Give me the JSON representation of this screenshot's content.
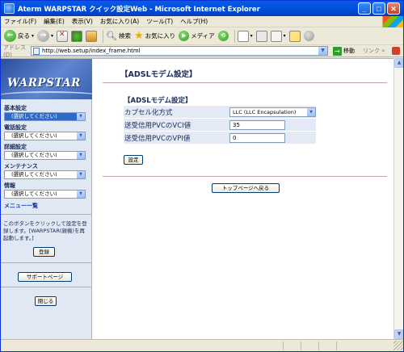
{
  "window": {
    "title": "Aterm WARPSTAR クイック設定Web - Microsoft Internet Explorer",
    "controls": {
      "minimize": "_",
      "maximize": "□",
      "close": "✕"
    }
  },
  "menu": [
    "ファイル(F)",
    "編集(E)",
    "表示(V)",
    "お気に入り(A)",
    "ツール(T)",
    "ヘルプ(H)"
  ],
  "toolbar": {
    "back": "戻る",
    "search": "検索",
    "favorites": "お気に入り",
    "media": "メディア"
  },
  "address": {
    "label": "アドレス(D)",
    "url": "http://web.setup/index_frame.html",
    "go": "移動",
    "links": "リンク »"
  },
  "sidebar": {
    "logo": "WARPSTAR",
    "groups": [
      {
        "label": "基本設定",
        "selected": "(選択してください)"
      },
      {
        "label": "電話設定",
        "selected": "(選択してください)"
      },
      {
        "label": "詳細設定",
        "selected": "(選択してください)"
      },
      {
        "label": "メンテナンス",
        "selected": "(選択してください)"
      },
      {
        "label": "情報",
        "selected": "(選択してください)"
      }
    ],
    "menu_list": "メニュー一覧",
    "help_text": "このボタンをクリックして設定を登録します。[WARPSTAR(親機)を再起動します。]",
    "register_button": "登録",
    "support_button": "サポートページ",
    "close_button": "閉じる"
  },
  "main": {
    "heading": "【ADSLモデム設定】",
    "section_title": "【ADSLモデム設定】",
    "rows": [
      {
        "label": "カプセル化方式",
        "value": "LLC (LLC Encapsulation)"
      },
      {
        "label": "送受信用PVCのVCI値",
        "value": "35"
      },
      {
        "label": "送受信用PVCのVPI値",
        "value": "0"
      }
    ],
    "set_button": "設定",
    "top_page_button": "トップページへ戻る"
  },
  "colors": {
    "titlebar": "#0053e1",
    "sidebar_bg": "#dfe8f3",
    "heading_text": "#1a2a55",
    "table_bg": "#e3e9f5"
  }
}
